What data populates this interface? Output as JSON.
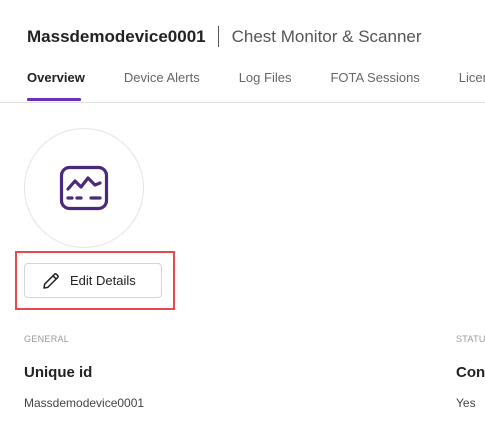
{
  "header": {
    "device_name": "Massdemodevice0001",
    "device_type": "Chest Monitor & Scanner"
  },
  "tabs": [
    {
      "label": "Overview",
      "active": true
    },
    {
      "label": "Device Alerts",
      "active": false
    },
    {
      "label": "Log Files",
      "active": false
    },
    {
      "label": "FOTA Sessions",
      "active": false
    },
    {
      "label": "Licen",
      "active": false
    }
  ],
  "device_icon": "monitor-waveform-icon",
  "edit_button": {
    "label": "Edit Details",
    "icon": "pencil-icon"
  },
  "general": {
    "section_label": "GENERAL",
    "field_label": "Unique id",
    "field_value": "Massdemodevice0001"
  },
  "status": {
    "section_label": "STATU",
    "field_label": "Con",
    "field_value": "Yes"
  },
  "colors": {
    "accent": "#6b2fbf",
    "icon": "#4a2a7a",
    "highlight": "#e5484d"
  }
}
